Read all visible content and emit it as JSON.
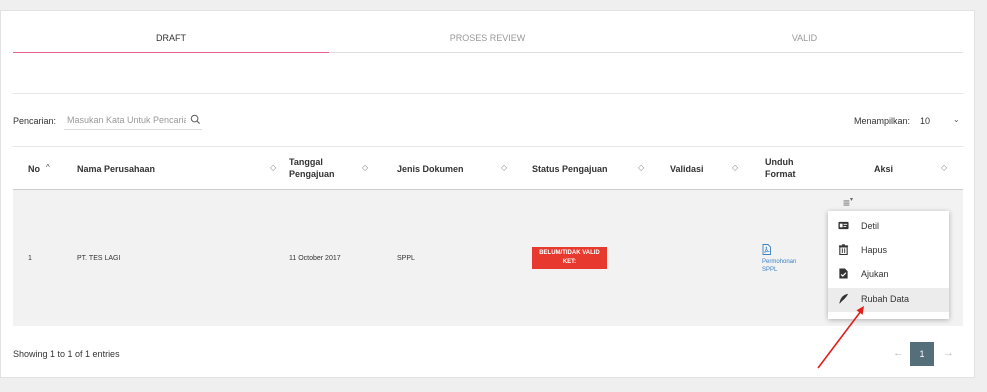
{
  "tabs": [
    {
      "label": "DRAFT",
      "active": true
    },
    {
      "label": "PROSES REVIEW",
      "active": false
    },
    {
      "label": "VALID",
      "active": false
    }
  ],
  "search": {
    "label": "Pencarian:",
    "placeholder": "Masukan Kata Untuk Pencarian"
  },
  "page_size": {
    "label": "Menampilkan:",
    "value": "10"
  },
  "table": {
    "headers": [
      "No",
      "Nama Perusahaan",
      "Tanggal Pengajuan",
      "Jenis Dokumen",
      "Status Pengajuan",
      "Validasi",
      "Unduh Format",
      "Aksi"
    ],
    "row": {
      "no": "1",
      "company": "PT. TES LAGI",
      "date": "11 October 2017",
      "doc_type": "SPPL",
      "status_line1": "BELUM/TIDAK VALID",
      "status_line2": "KET:",
      "download_line1": "Permohonan",
      "download_line2": "SPPL"
    }
  },
  "action_menu": {
    "items": [
      {
        "label": "Detil",
        "icon": "id-card-icon"
      },
      {
        "label": "Hapus",
        "icon": "trash-icon"
      },
      {
        "label": "Ajukan",
        "icon": "submit-file-icon"
      },
      {
        "label": "Rubah Data",
        "icon": "feather-icon"
      }
    ]
  },
  "footer": {
    "entries_text": "Showing 1 to 1 of 1 entries"
  },
  "pagination": {
    "current": "1",
    "prev": "←",
    "next": "→"
  },
  "colors": {
    "active_tab": "#e8608a",
    "status_badge": "#e8392e",
    "link": "#3b82c4",
    "page_button": "#546e7a",
    "annotation_arrow": "#e0201b"
  }
}
